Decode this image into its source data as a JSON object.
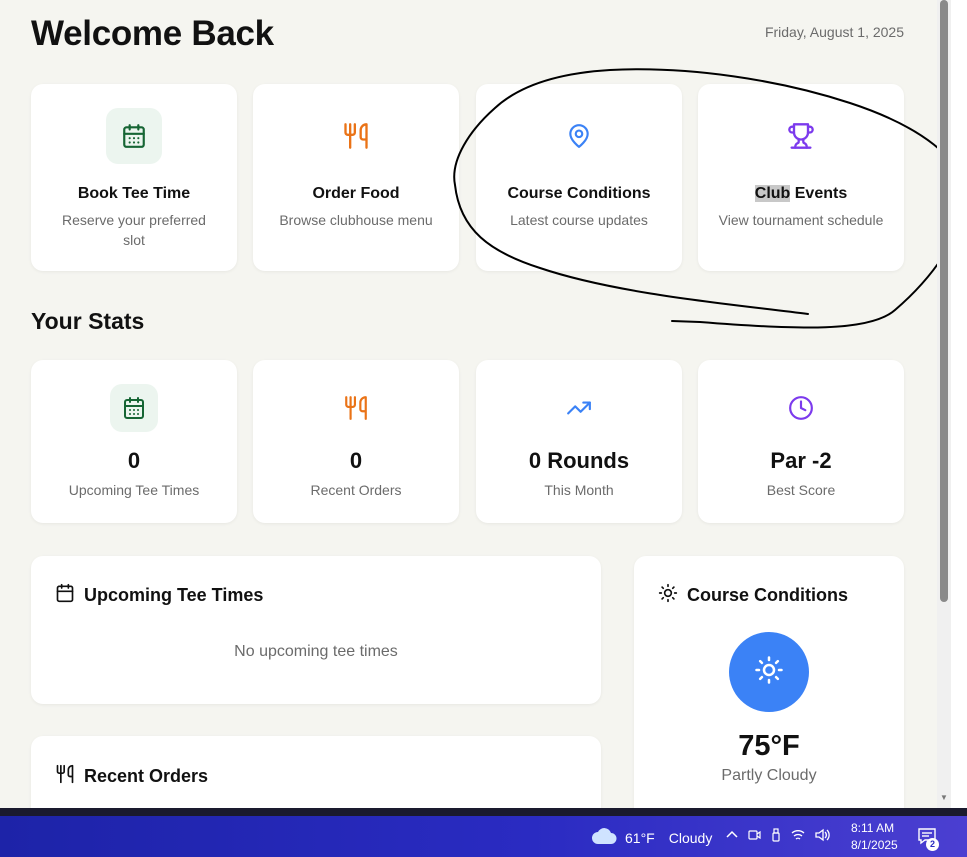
{
  "header": {
    "title": "Welcome Back",
    "date": "Friday, August 1, 2025"
  },
  "quick_actions": [
    {
      "title": "Book Tee Time",
      "subtitle": "Reserve your preferred slot",
      "icon": "calendar-icon",
      "color": "#166534",
      "bg": "#ecf5ef"
    },
    {
      "title": "Order Food",
      "subtitle": "Browse clubhouse menu",
      "icon": "utensils-icon",
      "color": "#ea7317",
      "bg": "#ffffff"
    },
    {
      "title": "Course Conditions",
      "subtitle": "Latest course updates",
      "icon": "map-pin-icon",
      "color": "#3b82f6",
      "bg": "#ffffff"
    },
    {
      "title_highlight": "Club",
      "title_rest": " Events",
      "subtitle": "View tournament schedule",
      "icon": "trophy-icon",
      "color": "#7c3aed",
      "bg": "#ffffff"
    }
  ],
  "stats_section": {
    "title": "Your Stats",
    "items": [
      {
        "value": "0",
        "label": "Upcoming Tee Times",
        "icon": "calendar-icon"
      },
      {
        "value": "0",
        "label": "Recent Orders",
        "icon": "utensils-icon"
      },
      {
        "value": "0 Rounds",
        "label": "This Month",
        "icon": "trending-up-icon"
      },
      {
        "value": "Par -2",
        "label": "Best Score",
        "icon": "clock-icon"
      }
    ]
  },
  "upcoming_panel": {
    "title": "Upcoming Tee Times",
    "empty_message": "No upcoming tee times"
  },
  "orders_panel": {
    "title": "Recent Orders"
  },
  "conditions_panel": {
    "title": "Course Conditions",
    "temperature": "75°F",
    "condition": "Partly Cloudy",
    "accent": "#3b82f6"
  },
  "taskbar": {
    "weather_temp": "61°F",
    "weather_text": "Cloudy",
    "time": "8:11 AM",
    "date": "8/1/2025",
    "notification_count": "2",
    "background": "#2a2bc2"
  }
}
